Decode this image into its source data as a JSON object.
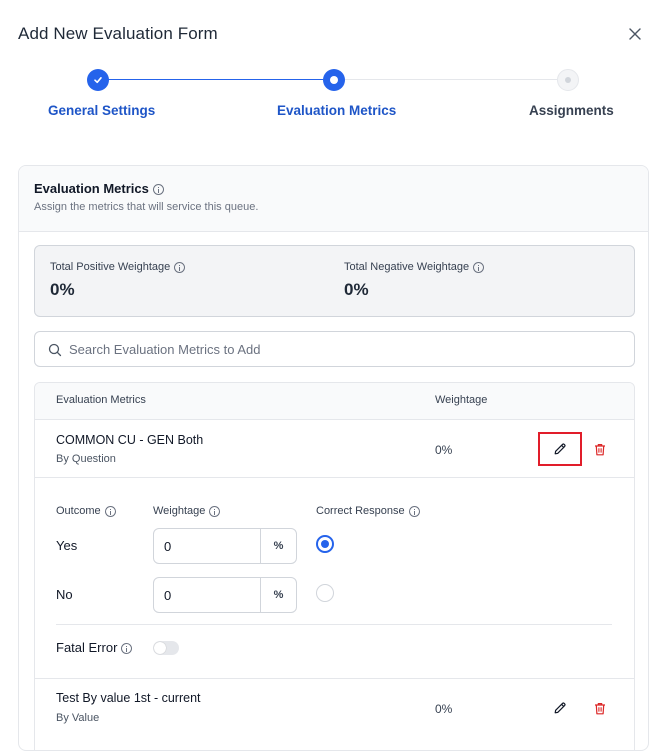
{
  "dialog": {
    "title": "Add New Evaluation Form"
  },
  "stepper": {
    "steps": [
      {
        "label": "General Settings",
        "state": "completed"
      },
      {
        "label": "Evaluation Metrics",
        "state": "active"
      },
      {
        "label": "Assignments",
        "state": "pending"
      }
    ]
  },
  "panel": {
    "title": "Evaluation Metrics",
    "subtitle": "Assign the metrics that will service this queue.",
    "totals": {
      "positive_label": "Total Positive Weightage",
      "positive_value": "0%",
      "negative_label": "Total Negative Weightage",
      "negative_value": "0%"
    },
    "search": {
      "placeholder": "Search Evaluation Metrics to Add",
      "value": ""
    },
    "table": {
      "headers": [
        "Evaluation Metrics",
        "Weightage"
      ],
      "rows": [
        {
          "name": "COMMON CU - GEN Both",
          "type": "By Question",
          "weightage": "0%",
          "expanded": true,
          "details": {
            "outcome_header": "Outcome",
            "weightage_header": "Weightage",
            "correct_header": "Correct Response",
            "options": [
              {
                "label": "Yes",
                "weightage": "0",
                "unit": "%",
                "correct": true
              },
              {
                "label": "No",
                "weightage": "0",
                "unit": "%",
                "correct": false
              }
            ],
            "fatal_error_label": "Fatal Error",
            "fatal_error_on": false
          }
        },
        {
          "name": "Test By value 1st - current",
          "type": "By Value",
          "weightage": "0%",
          "expanded": false
        }
      ]
    }
  },
  "colors": {
    "accent": "#2563eb",
    "delete": "#dc2626",
    "highlight": "#e11d2a"
  },
  "icons": {
    "close": "close-icon",
    "check": "check-icon",
    "info": "info-icon",
    "search": "search-icon",
    "edit": "pencil-icon",
    "delete": "trash-icon"
  }
}
